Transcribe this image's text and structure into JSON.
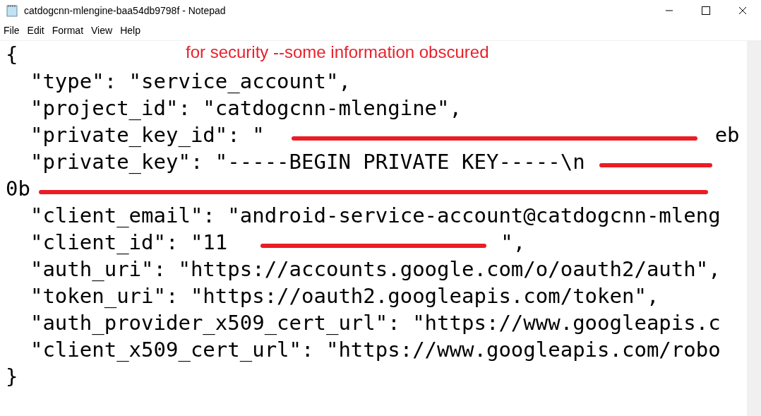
{
  "window": {
    "title": "catdogcnn-mlengine-baa54db9798f - Notepad"
  },
  "menu": [
    "File",
    "Edit",
    "Format",
    "View",
    "Help"
  ],
  "annotation": "for security --some information obscured",
  "lines": [
    [
      {
        "kind": "text",
        "text": "{"
      }
    ],
    [
      {
        "kind": "text",
        "text": "  \"type\": \"service_account\","
      }
    ],
    [
      {
        "kind": "text",
        "text": "  \"project_id\": \"catdogcnn-mlengine\","
      }
    ],
    [
      {
        "kind": "text",
        "text": "  \"private_key_id\": \""
      },
      {
        "kind": "redaction"
      },
      {
        "kind": "text",
        "text": "eb"
      }
    ],
    [
      {
        "kind": "text",
        "text": "  \"private_key\": \"-----BEGIN PRIVATE KEY-----\\n"
      },
      {
        "kind": "redaction"
      }
    ],
    [
      {
        "kind": "text",
        "text": "0b"
      },
      {
        "kind": "redaction"
      }
    ],
    [
      {
        "kind": "text",
        "text": "  \"client_email\": \"android-service-account@catdogcnn-mleng"
      }
    ],
    [
      {
        "kind": "text",
        "text": "  \"client_id\": \"11"
      },
      {
        "kind": "redaction"
      },
      {
        "kind": "text",
        "text": "\","
      }
    ],
    [
      {
        "kind": "text",
        "text": "  \"auth_uri\": \"https://accounts.google.com/o/oauth2/auth\","
      }
    ],
    [
      {
        "kind": "text",
        "text": "  \"token_uri\": \"https://oauth2.googleapis.com/token\","
      }
    ],
    [
      {
        "kind": "text",
        "text": "  \"auth_provider_x509_cert_url\": \"https://www.googleapis.c"
      }
    ],
    [
      {
        "kind": "text",
        "text": "  \"client_x509_cert_url\": \"https://www.googleapis.com/robo"
      }
    ],
    [
      {
        "kind": "text",
        "text": "}"
      }
    ]
  ]
}
